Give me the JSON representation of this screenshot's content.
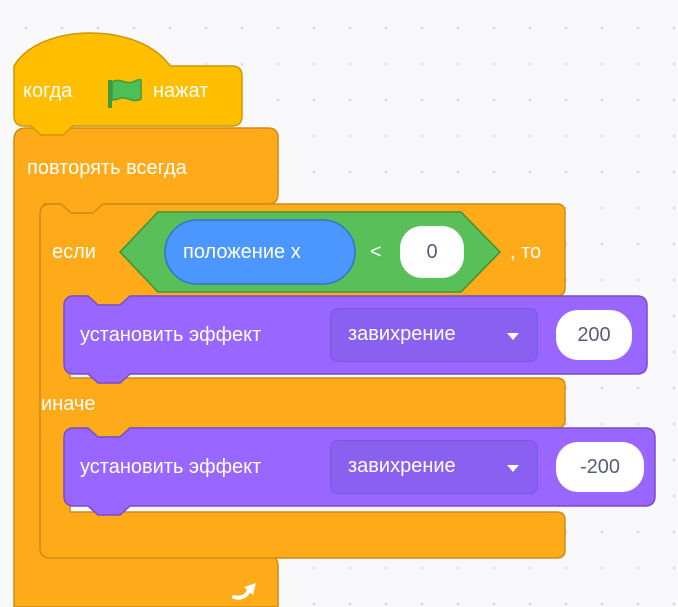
{
  "blocks": {
    "hat": {
      "prefix": "когда",
      "suffix": "нажат",
      "flag_icon": "green-flag-icon"
    },
    "forever": {
      "label": "повторять всегда",
      "loop_icon": "loop-arrow-icon"
    },
    "if_else": {
      "if_label": "если",
      "then_label": ", то",
      "else_label": "иначе",
      "condition": {
        "operator": "<",
        "left_reporter": "положение x",
        "right_value": "0"
      }
    },
    "set_effect_1": {
      "label": "установить эффект",
      "effect": "завихрение",
      "value": "200"
    },
    "set_effect_2": {
      "label": "установить эффект",
      "effect": "завихрение",
      "value": "-200"
    }
  },
  "colors": {
    "events": "#ffbf00",
    "control": "#ffab19",
    "operators": "#59c059",
    "motion": "#4c97ff",
    "looks": "#9966ff"
  }
}
